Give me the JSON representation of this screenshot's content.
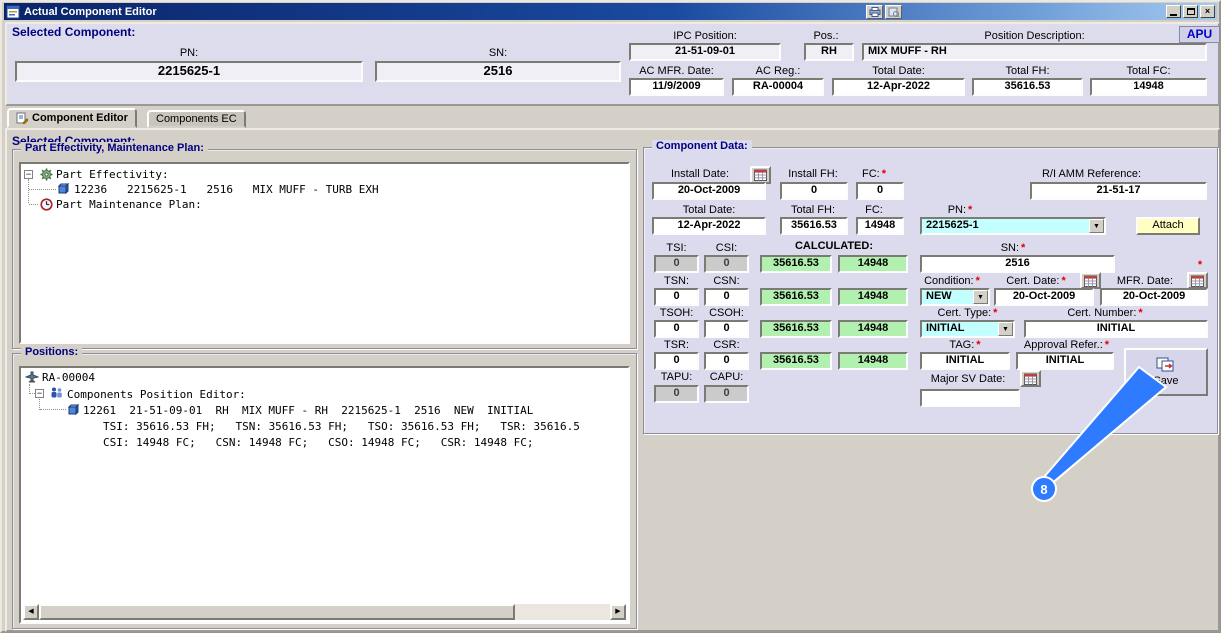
{
  "titlebar": {
    "title": "Actual Component Editor"
  },
  "icons": {
    "dropdown_arrow": "▼",
    "scroll_left_arrow": "◀",
    "scroll_right_arrow": "▶",
    "tree_expander": "−",
    "close": "×"
  },
  "header": {
    "section_title": "Selected Component:",
    "apu_badge": "APU",
    "pn": {
      "label": "PN:",
      "value": "2215625-1"
    },
    "sn": {
      "label": "SN:",
      "value": "2516"
    },
    "ipc_position": {
      "label": "IPC Position:",
      "value": "21-51-09-01"
    },
    "pos": {
      "label": "Pos.:",
      "value": "RH"
    },
    "position_description": {
      "label": "Position Description:",
      "value": "MIX MUFF - RH"
    },
    "ac_mfr_date": {
      "label": "AC MFR. Date:",
      "value": "11/9/2009"
    },
    "ac_reg": {
      "label": "AC Reg.:",
      "value": "RA-00004"
    },
    "total_date": {
      "label": "Total Date:",
      "value": "12-Apr-2022"
    },
    "total_fh": {
      "label": "Total FH:",
      "value": "35616.53"
    },
    "total_fc": {
      "label": "Total FC:",
      "value": "14948"
    }
  },
  "tabs": {
    "component_editor": "Component Editor",
    "components_ec": "Components EC"
  },
  "main": {
    "section_title": "Selected Component:",
    "part_effectivity": {
      "group_title": "Part Effectivity, Maintenance Plan:",
      "root1": "Part Effectivity:",
      "item1": "12236   2215625-1   2516   MIX MUFF - TURB EXH",
      "root2": "Part Maintenance Plan:"
    },
    "positions": {
      "group_title": "Positions:",
      "root": "RA-00004",
      "node": "Components Position Editor:",
      "item": "12261  21-51-09-01  RH  MIX MUFF - RH  2215625-1  2516  NEW  INITIAL",
      "detail1": "TSI: 35616.53 FH;   TSN: 35616.53 FH;   TSO: 35616.53 FH;   TSR: 35616.5",
      "detail2": "CSI: 14948 FC;   CSN: 14948 FC;   CSO: 14948 FC;   CSR: 14948 FC;"
    }
  },
  "component_data": {
    "group_title": "Component Data:",
    "required_marker": "*",
    "install_date": {
      "label": "Install Date:",
      "value": "20-Oct-2009"
    },
    "install_fh": {
      "label": "Install FH:",
      "value": "0"
    },
    "install_fc": {
      "label": "FC:",
      "value": "0"
    },
    "ri_amm": {
      "label": "R/I AMM Reference:",
      "value": "21-51-17"
    },
    "total_date": {
      "label": "Total Date:",
      "value": "12-Apr-2022"
    },
    "total_fh": {
      "label": "Total FH:",
      "value": "35616.53"
    },
    "total_fc": {
      "label": "FC:",
      "value": "14948"
    },
    "pn": {
      "label": "PN:",
      "value": "2215625-1"
    },
    "attach_button": "Attach",
    "sn": {
      "label": "SN:",
      "value": "2516"
    },
    "calculated_label": "CALCULATED:",
    "calc_fh": "35616.53",
    "calc_fc": "14948",
    "tsi": {
      "label": "TSI:",
      "value": "0"
    },
    "csi": {
      "label": "CSI:",
      "value": "0"
    },
    "tsn": {
      "label": "TSN:",
      "value": "0"
    },
    "csn": {
      "label": "CSN:",
      "value": "0"
    },
    "tsoh": {
      "label": "TSOH:",
      "value": "0"
    },
    "csoh": {
      "label": "CSOH:",
      "value": "0"
    },
    "tsr": {
      "label": "TSR:",
      "value": "0"
    },
    "csr": {
      "label": "CSR:",
      "value": "0"
    },
    "tapu": {
      "label": "TAPU:",
      "value": "0"
    },
    "capu": {
      "label": "CAPU:",
      "value": "0"
    },
    "condition": {
      "label": "Condition:",
      "value": "NEW"
    },
    "cert_date": {
      "label": "Cert. Date:",
      "value": "20-Oct-2009"
    },
    "mfr_date": {
      "label": "MFR. Date:",
      "value": "20-Oct-2009"
    },
    "cert_type": {
      "label": "Cert. Type:",
      "value": "INITIAL"
    },
    "cert_number": {
      "label": "Cert. Number:",
      "value": "INITIAL"
    },
    "tag": {
      "label": "TAG:",
      "value": "INITIAL"
    },
    "approval_refer": {
      "label": "Approval Refer.:",
      "value": "INITIAL"
    },
    "major_sv_date": {
      "label": "Major SV Date:",
      "value": ""
    },
    "save_button": "Save",
    "callout_number": "8"
  },
  "colors": {
    "calculated_green": "#b2f0b0",
    "combo_cyan": "#c4ffff",
    "panel_lavender": "#dcdbee",
    "section_title_navy": "#000080",
    "required_red": "#e00000",
    "attach_yellow": "#ffffc2",
    "callout_blue": "#2e7bff"
  }
}
